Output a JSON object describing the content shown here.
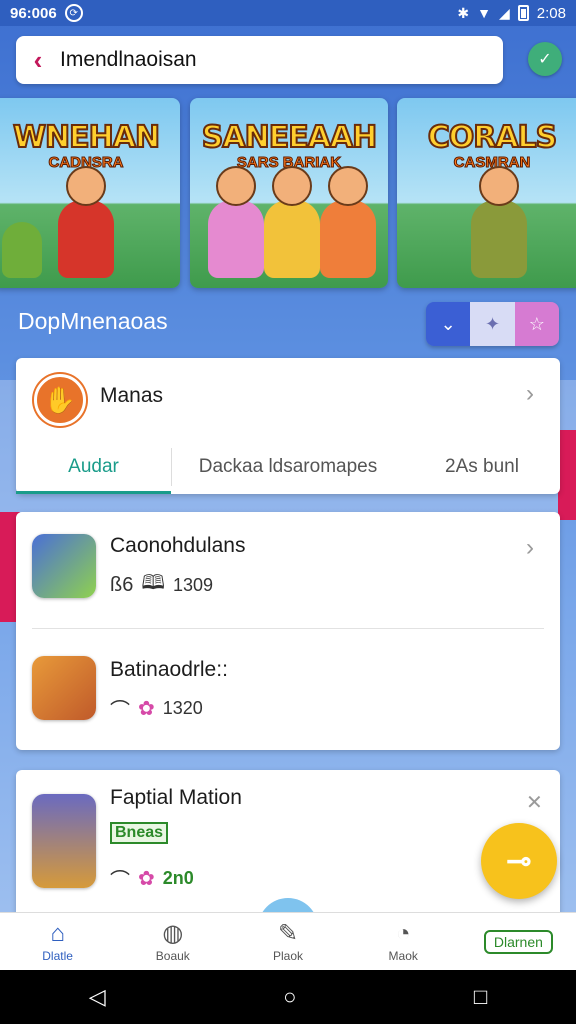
{
  "status_bar": {
    "time_left": "96:006",
    "time_right": "2:08"
  },
  "search": {
    "query": "Imendlnaoisan"
  },
  "banners": [
    {
      "title": "WNEHAN",
      "subtitle": "CADNSRA"
    },
    {
      "title": "SANEEAAH",
      "subtitle": "SARS BARIAK"
    },
    {
      "title": "CORALS",
      "subtitle": "CASMRAN"
    }
  ],
  "section": {
    "title": "DopMnenaoas"
  },
  "filter_card": {
    "name": "Manas",
    "tabs": [
      "Audar",
      "Dackaa ldsaromapes",
      "2As bunl"
    ]
  },
  "list": [
    {
      "title": "Caonohdulans",
      "meta_value": "1309",
      "meta_glyph_a": "ß6"
    },
    {
      "title": "Batinaodrle::",
      "meta_value": "1320",
      "meta_glyph_a": "⌒"
    }
  ],
  "featured": {
    "title": "Faptial Mation",
    "tag": "Bneas",
    "value": "2n0"
  },
  "bottom_nav": [
    {
      "label": "Dlatle",
      "icon": "home-icon"
    },
    {
      "label": "Boauk",
      "icon": "globe-icon"
    },
    {
      "label": "Plaok",
      "icon": "pen-icon"
    },
    {
      "label": "Maok",
      "icon": "timer-icon"
    },
    {
      "label": "Dlarnen",
      "icon": ""
    }
  ],
  "colors": {
    "accent": "#2f5fbf",
    "tab_active": "#1a9c8a",
    "fab": "#f7c21c",
    "pink": "#d81b58"
  }
}
